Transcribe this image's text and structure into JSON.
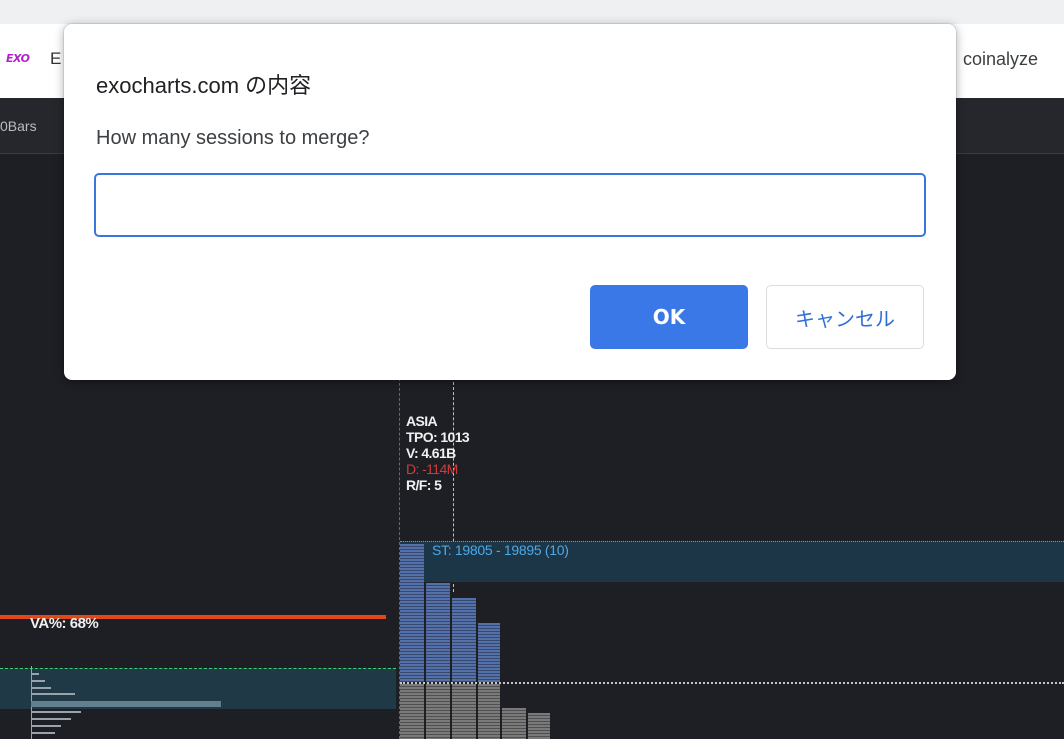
{
  "bookmarks": {
    "logo_text": "EXO",
    "first_item_fragment": "E",
    "right_item": "coinalyze"
  },
  "toolbar": {
    "first_item_fragment": "0Bars"
  },
  "chart": {
    "session": {
      "name": "ASIA",
      "tpo": "TPO: 1013",
      "volume": "V: 4.61B",
      "delta": "D: -114M",
      "rf": "R/F: 5"
    },
    "single_print_label": "ST: 19805 - 19895 (10)",
    "value_area_label": "VA%: 68%",
    "colors": {
      "background": "#1d1f24",
      "poc_line": "#e2471a",
      "single_print_text": "#4ea8e6",
      "delta_negative": "#d03a3a",
      "profile_blue": "#5470a8",
      "profile_gray": "#7a7a7a"
    }
  },
  "dialog": {
    "title": "exocharts.com の内容",
    "message": "How many sessions to merge?",
    "input_value": "",
    "ok_label": "OK",
    "cancel_label": "キャンセル",
    "accent_color": "#3b78e7"
  }
}
